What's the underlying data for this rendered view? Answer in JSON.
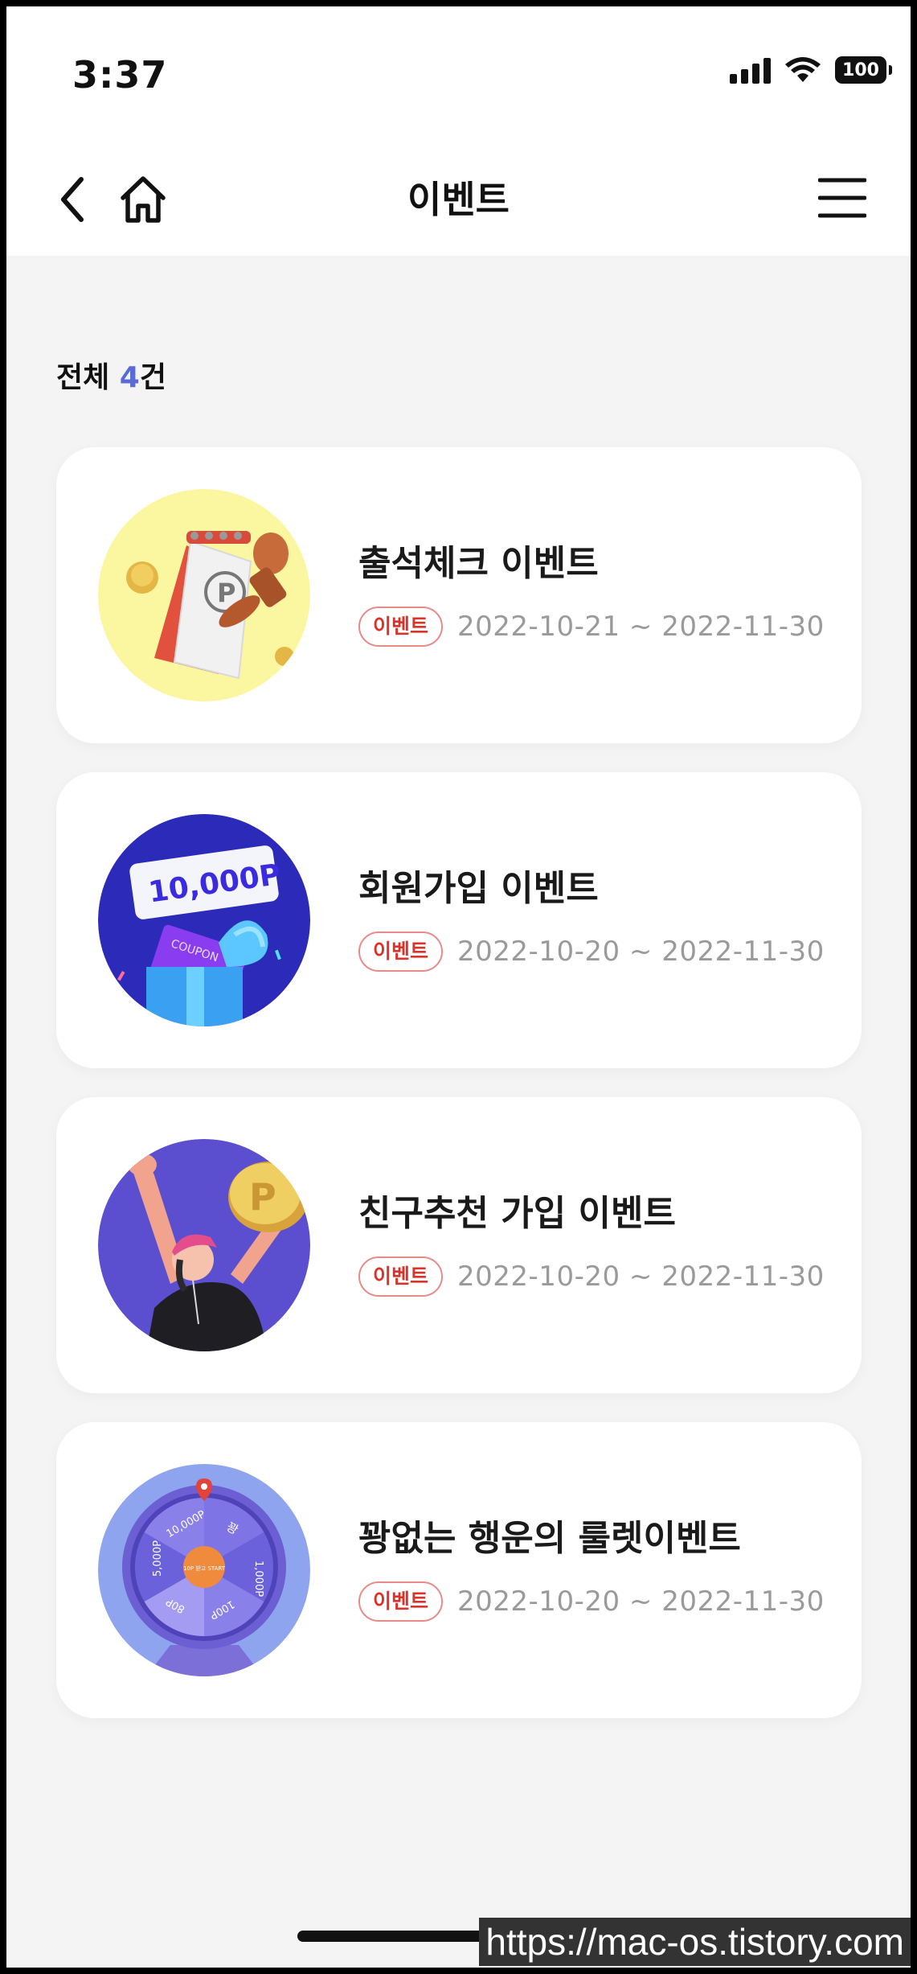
{
  "status_bar": {
    "time": "3:37",
    "battery": "100"
  },
  "nav": {
    "title": "이벤트",
    "back_icon": "chevron-left-icon",
    "home_icon": "home-icon",
    "menu_icon": "hamburger-menu-icon"
  },
  "list": {
    "count_prefix": "전체 ",
    "count_value": "4",
    "count_suffix": "건",
    "items": [
      {
        "title": "출석체크 이벤트",
        "badge": "이벤트",
        "dates": "2022-10-21 ~ 2022-11-30",
        "thumb_icon": "attendance-calendar-stamp-icon"
      },
      {
        "title": "회원가입 이벤트",
        "badge": "이벤트",
        "dates": "2022-10-20 ~ 2022-11-30",
        "thumb_icon": "gift-box-coupon-icon",
        "thumb_text": "10,000P"
      },
      {
        "title": "친구추천 가입 이벤트",
        "badge": "이벤트",
        "dates": "2022-10-20 ~ 2022-11-30",
        "thumb_icon": "person-catching-coin-icon"
      },
      {
        "title": "꽝없는 행운의 룰렛이벤트",
        "badge": "이벤트",
        "dates": "2022-10-20 ~ 2022-11-30",
        "thumb_icon": "roulette-wheel-icon",
        "roulette_labels": [
          "10,000P",
          "꽝",
          "1,000P",
          "100P",
          "80P",
          "5,000P"
        ],
        "roulette_center": "10P 받고 START"
      }
    ]
  },
  "watermark": "https://mac-os.tistory.com",
  "colors": {
    "accent": "#5a6bd8",
    "badge_red": "#d9342b",
    "background": "#f4f4f4"
  }
}
